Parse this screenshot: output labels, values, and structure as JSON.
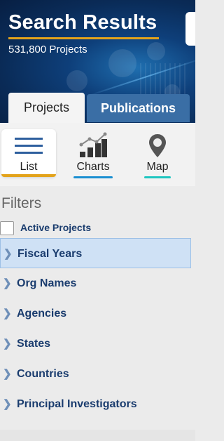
{
  "header": {
    "title": "Search Results",
    "count": "531,800 Projects"
  },
  "tabs": [
    {
      "label": "Projects",
      "active": true
    },
    {
      "label": "Publications",
      "active": false
    }
  ],
  "views": [
    {
      "label": "List",
      "icon": "list-icon",
      "active": true
    },
    {
      "label": "Charts",
      "icon": "bar-chart-icon",
      "active": false
    },
    {
      "label": "Map",
      "icon": "map-pin-icon",
      "active": false
    }
  ],
  "filters": {
    "title": "Filters",
    "active_projects_label": "Active Projects",
    "items": [
      {
        "label": "Fiscal Years",
        "selected": true
      },
      {
        "label": "Org Names",
        "selected": false
      },
      {
        "label": "Agencies",
        "selected": false
      },
      {
        "label": "States",
        "selected": false
      },
      {
        "label": "Countries",
        "selected": false
      },
      {
        "label": "Principal Investigators",
        "selected": false
      }
    ]
  },
  "colors": {
    "accent_gold": "#e3a31b",
    "accent_teal": "#1fc6c0",
    "accent_blue": "#1a8fd1",
    "link_navy": "#1a3c6e",
    "tab_blue": "#3a6ea5",
    "selected_bg": "#cfe1f5"
  }
}
